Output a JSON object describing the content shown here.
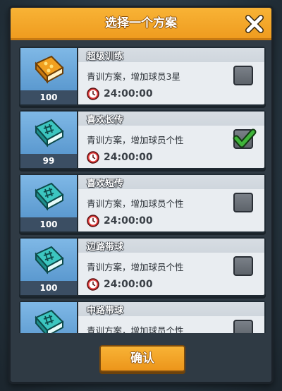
{
  "dialog": {
    "title": "选择一个方案",
    "confirm_label": "确认"
  },
  "items": [
    {
      "name": "超级训练",
      "description": "青训方案，增加球员3星",
      "timer": "24:00:00",
      "count": "100",
      "checked": false,
      "icon": "gold-book-icon"
    },
    {
      "name": "喜欢长传",
      "description": "青训方案，增加球员个性",
      "timer": "24:00:00",
      "count": "99",
      "checked": true,
      "icon": "teal-book-icon"
    },
    {
      "name": "喜欢短传",
      "description": "青训方案，增加球员个性",
      "timer": "24:00:00",
      "count": "100",
      "checked": false,
      "icon": "teal-book-icon"
    },
    {
      "name": "边路带球",
      "description": "青训方案，增加球员个性",
      "timer": "24:00:00",
      "count": "100",
      "checked": false,
      "icon": "teal-book-icon"
    },
    {
      "name": "中路带球",
      "description": "青训方案，增加球员个性",
      "timer": "",
      "count": "",
      "checked": false,
      "icon": "teal-book-icon"
    }
  ],
  "colors": {
    "header": "#f8b336",
    "card": "#e9edf1",
    "tile": "#6aa6da",
    "check_green": "#3fb43a"
  }
}
